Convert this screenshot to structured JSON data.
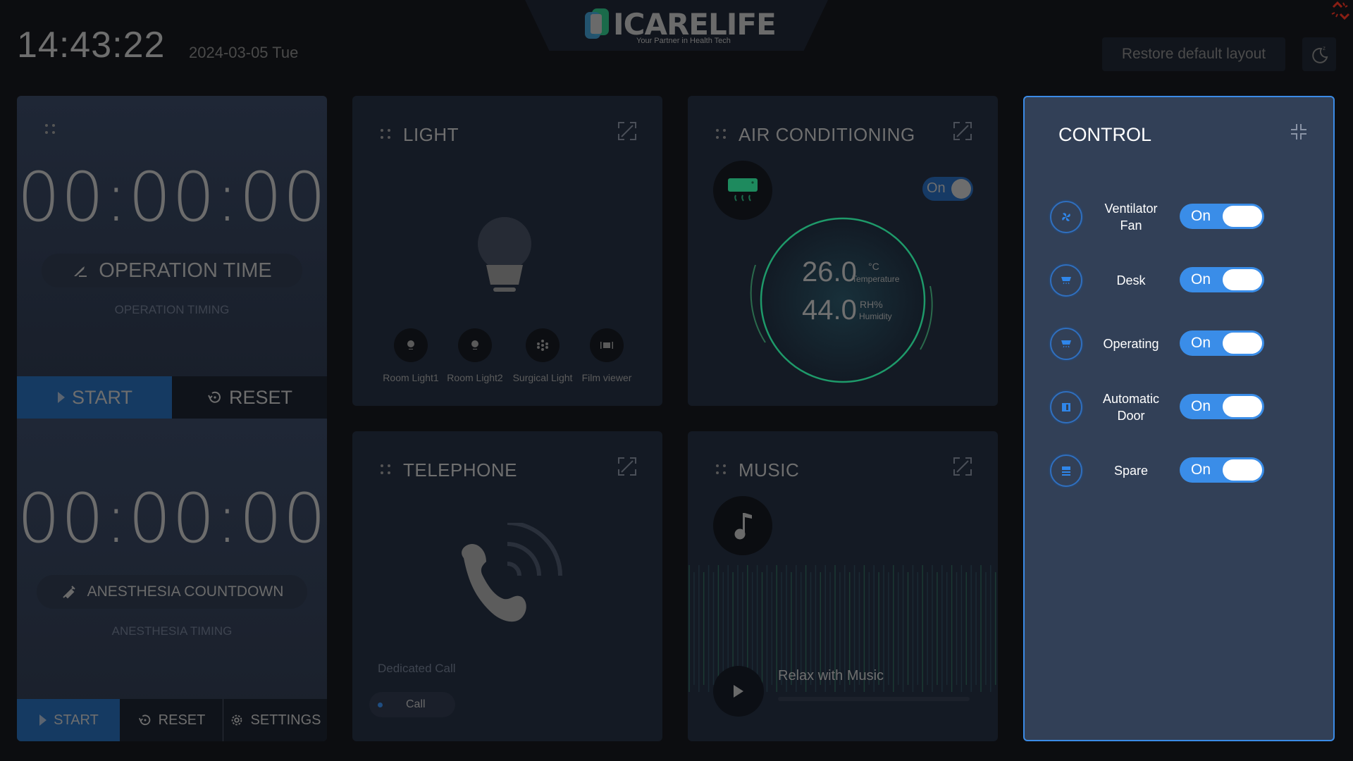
{
  "header": {
    "brand": "ICARELIFE",
    "tagline": "Your Partner in Health Tech",
    "time": "14:43:22",
    "date": "2024-03-05 Tue",
    "restore_label": "Restore default layout",
    "sleep_icon": "moon-sleep-icon",
    "connection_icon": "disconnected-link-icon"
  },
  "colors": {
    "accent": "#3a8de8",
    "start_button": "#153a62",
    "ac_green": "#1e9a6a",
    "control_panel": "#324057",
    "disconnected": "#8a1e14"
  },
  "timers": {
    "operation": {
      "display": "00:00:00",
      "title": "OPERATION TIME",
      "subtitle": "OPERATION TIMING",
      "start_label": "START",
      "reset_label": "RESET"
    },
    "anesthesia": {
      "display": "00:00:00",
      "title": "ANESTHESIA COUNTDOWN",
      "subtitle": "ANESTHESIA TIMING",
      "start_label": "START",
      "reset_label": "RESET",
      "settings_label": "SETTINGS"
    }
  },
  "light": {
    "title": "LIGHT",
    "options": [
      {
        "label": "Room Light1",
        "icon": "bulb-icon"
      },
      {
        "label": "Room Light2",
        "icon": "bulb-icon"
      },
      {
        "label": "Surgical Light",
        "icon": "surgical-light-icon"
      },
      {
        "label": "Film viewer",
        "icon": "film-viewer-icon"
      }
    ]
  },
  "air_conditioning": {
    "title": "AIR CONDITIONING",
    "toggle_label": "On",
    "temperature": "26.0",
    "temperature_unit": "°C",
    "temperature_label": "Temperature",
    "humidity": "44.0",
    "humidity_unit": "RH%",
    "humidity_label": "Humidity"
  },
  "telephone": {
    "title": "TELEPHONE",
    "label": "Dedicated Call",
    "call_label": "Call"
  },
  "music": {
    "title": "MUSIC",
    "track": "Relax with Music",
    "progress": 0
  },
  "control": {
    "title": "CONTROL",
    "items": [
      {
        "label": "Ventilator Fan",
        "state": "On",
        "icon": "fan-icon"
      },
      {
        "label": "Desk",
        "state": "On",
        "icon": "desk-light-icon"
      },
      {
        "label": "Operating",
        "state": "On",
        "icon": "operating-light-icon"
      },
      {
        "label": "Automatic Door",
        "state": "On",
        "icon": "door-icon"
      },
      {
        "label": "Spare",
        "state": "On",
        "icon": "spare-icon"
      }
    ]
  }
}
